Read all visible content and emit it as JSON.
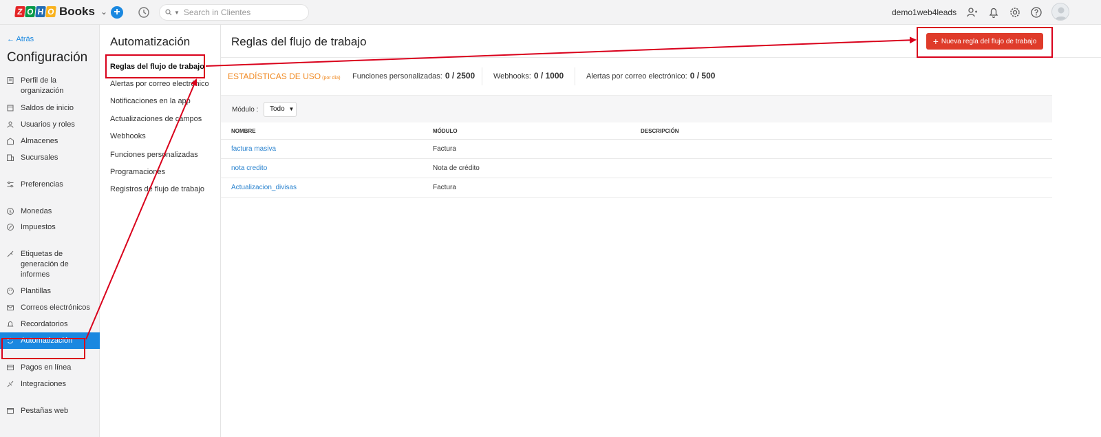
{
  "topbar": {
    "logo_letters": [
      "Z",
      "O",
      "H",
      "O"
    ],
    "logo_colors": [
      "#e42527",
      "#089949",
      "#226db4",
      "#f9b21d"
    ],
    "app_name": "Books",
    "search_placeholder": "Search in Clientes",
    "user_name": "demo1web4leads"
  },
  "sidebar": {
    "back_label": "Atrás",
    "title": "Configuración",
    "items": [
      {
        "label": "Perfil de la organización",
        "icon": "building-icon"
      },
      {
        "label": "Saldos de inicio",
        "icon": "calendar-icon"
      },
      {
        "label": "Usuarios y roles",
        "icon": "users-icon"
      },
      {
        "label": "Almacenes",
        "icon": "warehouse-icon"
      },
      {
        "label": "Sucursales",
        "icon": "branches-icon"
      },
      {
        "label": "Preferencias",
        "icon": "sliders-icon"
      },
      {
        "label": "Monedas",
        "icon": "currency-icon"
      },
      {
        "label": "Impuestos",
        "icon": "percent-icon"
      },
      {
        "label": "Etiquetas de generación de informes",
        "icon": "tag-icon"
      },
      {
        "label": "Plantillas",
        "icon": "palette-icon"
      },
      {
        "label": "Correos electrónicos",
        "icon": "mail-icon"
      },
      {
        "label": "Recordatorios",
        "icon": "bell-icon"
      },
      {
        "label": "Automatización",
        "icon": "automation-icon"
      },
      {
        "label": "Pagos en línea",
        "icon": "card-icon"
      },
      {
        "label": "Integraciones",
        "icon": "integration-icon"
      },
      {
        "label": "Pestañas web",
        "icon": "web-tabs-icon"
      }
    ]
  },
  "submenu": {
    "title": "Automatización",
    "items": [
      "Reglas del flujo de trabajo",
      "Alertas por correo electrónico",
      "Notificaciones en la app",
      "Actualizaciones de campos",
      "Webhooks",
      "Funciones personalizadas",
      "Programaciones",
      "Registros de flujo de trabajo"
    ]
  },
  "main": {
    "title": "Reglas del flujo de trabajo",
    "new_button": "Nueva regla del flujo de trabajo",
    "stats": {
      "label": "ESTADÍSTICAS DE USO",
      "sublabel": "(por día)",
      "items": [
        {
          "label": "Funciones personalizadas:",
          "value": "0 / 2500"
        },
        {
          "label": "Webhooks:",
          "value": "0 / 1000"
        },
        {
          "label": "Alertas por correo electrónico:",
          "value": "0 / 500"
        }
      ]
    },
    "filter": {
      "label": "Módulo :",
      "value": "Todo"
    },
    "table": {
      "headers": [
        "NOMBRE",
        "MÓDULO",
        "DESCRIPCIÓN"
      ],
      "rows": [
        {
          "name": "factura masiva",
          "module": "Factura",
          "description": ""
        },
        {
          "name": "nota credito",
          "module": "Nota de crédito",
          "description": ""
        },
        {
          "name": "Actualizacion_divisas",
          "module": "Factura",
          "description": ""
        }
      ]
    }
  },
  "colors": {
    "accent": "#1a88e0",
    "button": "#df3b2a",
    "annotation": "#d9001b",
    "stats_label": "#f08a24",
    "link": "#2a83cf"
  }
}
